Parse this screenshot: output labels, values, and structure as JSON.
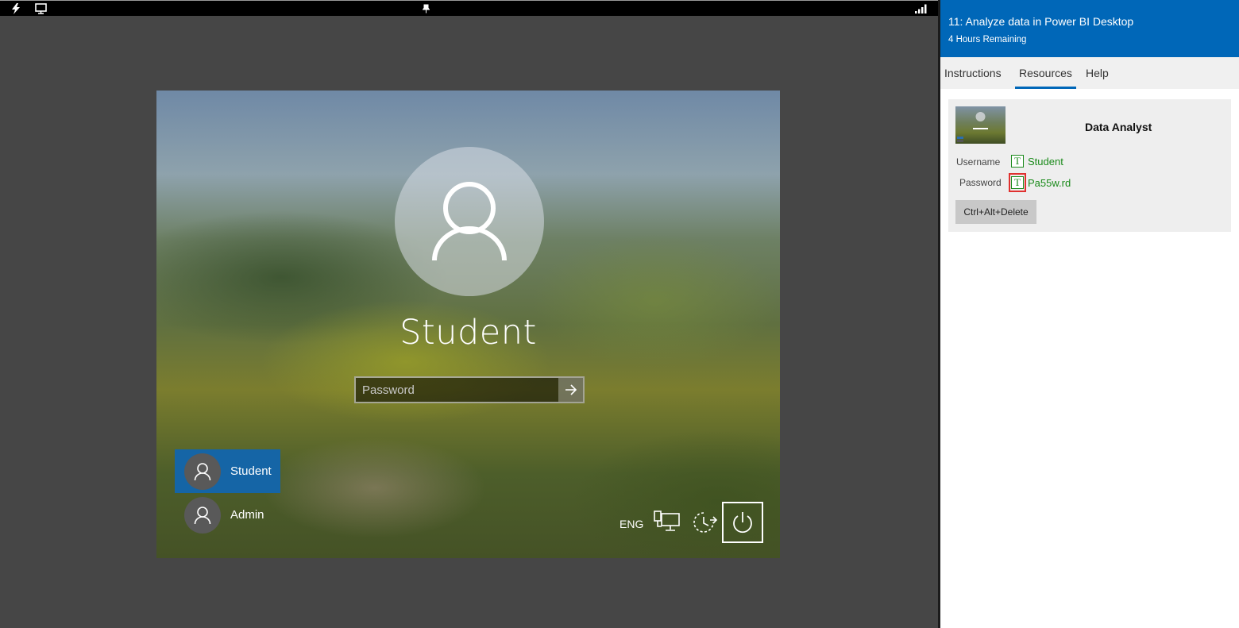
{
  "lock_screen": {
    "user_name": "Student",
    "password_placeholder": "Password",
    "accounts": [
      {
        "name": "Student",
        "selected": true
      },
      {
        "name": "Admin",
        "selected": false
      }
    ],
    "language": "ENG",
    "icons": [
      "network-icon",
      "ease-of-access-icon",
      "power-icon"
    ]
  },
  "lab": {
    "title": "11: Analyze data in Power BI Desktop",
    "time_remaining": "4 Hours Remaining",
    "tabs": [
      {
        "label": "Instructions",
        "active": false
      },
      {
        "label": "Resources",
        "active": true
      },
      {
        "label": "Help",
        "active": false
      }
    ],
    "resource": {
      "vm_name": "Data Analyst",
      "username_label": "Username",
      "username_value": "Student",
      "password_label": "Password",
      "password_value": "Pa55w.rd",
      "ctrl_alt_delete_label": "Ctrl+Alt+Delete"
    }
  },
  "colors": {
    "header_blue": "#0067b8",
    "selected_account": "#1565a6",
    "credential_green": "#1a8a1a",
    "highlight_red": "#e0312f"
  }
}
